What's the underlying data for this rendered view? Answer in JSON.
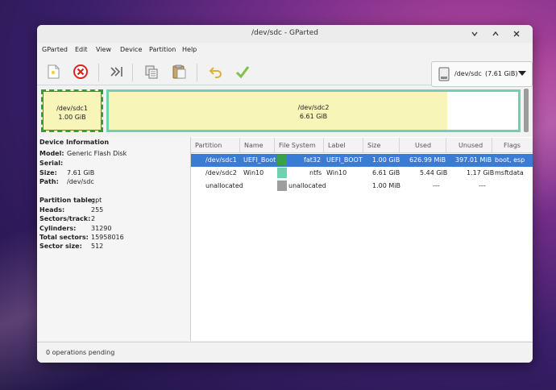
{
  "window": {
    "title": "/dev/sdc - GParted"
  },
  "menu": [
    "GParted",
    "Edit",
    "View",
    "Device",
    "Partition",
    "Help"
  ],
  "toolbar": {
    "icons": [
      "new-partition-icon",
      "delete-icon",
      "resize-move-icon",
      "copy-icon",
      "paste-icon",
      "undo-icon",
      "apply-icon"
    ]
  },
  "device_selector": {
    "device": "/dev/sdc",
    "size": "(7.61 GiB)"
  },
  "graph": {
    "parts": [
      {
        "name": "/dev/sdc1",
        "size": "1.00 GiB"
      },
      {
        "name": "/dev/sdc2",
        "size": "6.61 GiB"
      }
    ]
  },
  "device_info": {
    "heading": "Device Information",
    "rows1": [
      {
        "k": "Model:",
        "v": "Generic Flash Disk"
      },
      {
        "k": "Serial:",
        "v": ""
      },
      {
        "k": "Size:",
        "v": "7.61 GiB"
      },
      {
        "k": "Path:",
        "v": "/dev/sdc"
      }
    ],
    "rows2": [
      {
        "k": "Partition table:",
        "v": "gpt"
      },
      {
        "k": "Heads:",
        "v": "255"
      },
      {
        "k": "Sectors/track:",
        "v": "2"
      },
      {
        "k": "Cylinders:",
        "v": "31290"
      },
      {
        "k": "Total sectors:",
        "v": "15958016"
      },
      {
        "k": "Sector size:",
        "v": "512"
      }
    ]
  },
  "table": {
    "headers": [
      "Partition",
      "Name",
      "File System",
      "Label",
      "Size",
      "Used",
      "Unused",
      "Flags"
    ],
    "rows": [
      {
        "partition": "/dev/sdc1",
        "name": "UEFI_Boot",
        "fs": "fat32",
        "label": "UEFI_BOOT",
        "size": "1.00 GiB",
        "used": "626.99 MiB",
        "unused": "397.01 MiB",
        "flags": "boot, esp",
        "color": "#3aa14a"
      },
      {
        "partition": "/dev/sdc2",
        "name": "Win10",
        "fs": "ntfs",
        "label": "Win10",
        "size": "6.61 GiB",
        "used": "5.44 GiB",
        "unused": "1.17 GiB",
        "flags": "msftdata",
        "color": "#6fd1b0"
      },
      {
        "partition": "unallocated",
        "name": "",
        "fs": "unallocated",
        "label": "",
        "size": "1.00 MiB",
        "used": "---",
        "unused": "---",
        "flags": "",
        "color": "#9e9e9e"
      }
    ]
  },
  "status": {
    "text": "0 operations pending"
  },
  "colors": {
    "selection": "#3a7bd5",
    "fat32": "#3aa14a",
    "ntfs": "#6fd1b0",
    "unallocated": "#9e9e9e",
    "used_fill": "#f7f5b8"
  }
}
